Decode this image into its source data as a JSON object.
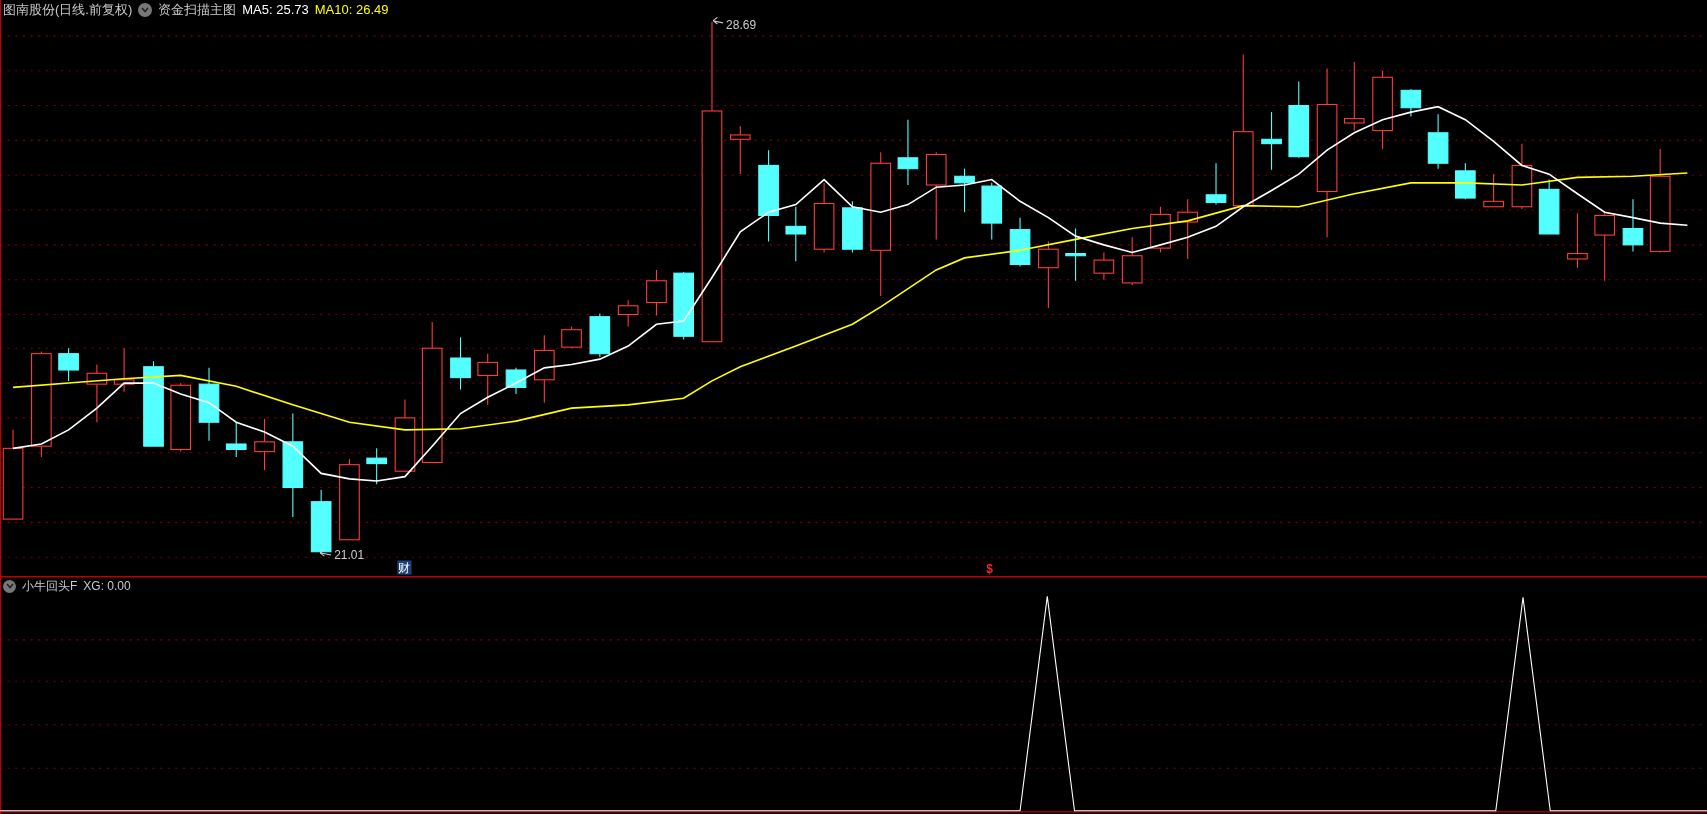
{
  "header": {
    "stock_title": "图南股份(日线.前复权)",
    "indicator_name": "资金扫描主图",
    "ma_readings": [
      {
        "label": "MA5: 25.73",
        "color": "#ffffff"
      },
      {
        "label": "MA10: 26.49",
        "color": "#ffff00"
      }
    ]
  },
  "main_chart": {
    "high_label": "28.69",
    "low_label": "21.01",
    "markers": [
      {
        "kind": "finance",
        "text": "财"
      },
      {
        "kind": "dollar",
        "text": "$"
      }
    ]
  },
  "indicator_panel": {
    "title": "小牛回头F",
    "reading": "XG: 0.00"
  }
}
